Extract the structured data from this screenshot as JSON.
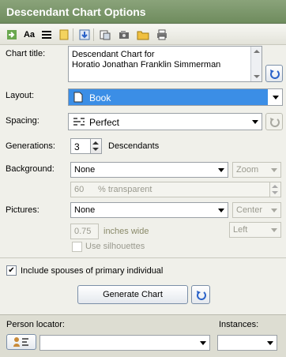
{
  "window": {
    "title": "Descendant Chart Options"
  },
  "toolbar": {
    "icons": [
      "import-icon",
      "font-icon",
      "line-style-icon",
      "note-icon",
      "save-icon",
      "chart-icon",
      "export-icon",
      "folder-open-icon",
      "print-icon"
    ]
  },
  "chart_title": {
    "label": "Chart title:",
    "line1": "Descendant Chart for",
    "line2": "Horatio Jonathan Franklin Simmerman"
  },
  "layout": {
    "label": "Layout:",
    "value": "Book"
  },
  "spacing": {
    "label": "Spacing:",
    "value": "Perfect"
  },
  "generations": {
    "label": "Generations:",
    "value": "3",
    "suffix": "Descendants"
  },
  "background": {
    "label": "Background:",
    "value": "None",
    "fit": "Zoom",
    "transparency_value": "60",
    "transparency_label": "% transparent"
  },
  "pictures": {
    "label": "Pictures:",
    "value": "None",
    "align": "Center",
    "width_value": "0.75",
    "width_label": "inches wide",
    "side": "Left",
    "silhouettes_label": "Use silhouettes"
  },
  "spouses": {
    "label": "Include spouses of primary individual",
    "checked": true
  },
  "generate": {
    "label": "Generate Chart"
  },
  "footer": {
    "person_locator_label": "Person locator:",
    "instances_label": "Instances:"
  }
}
